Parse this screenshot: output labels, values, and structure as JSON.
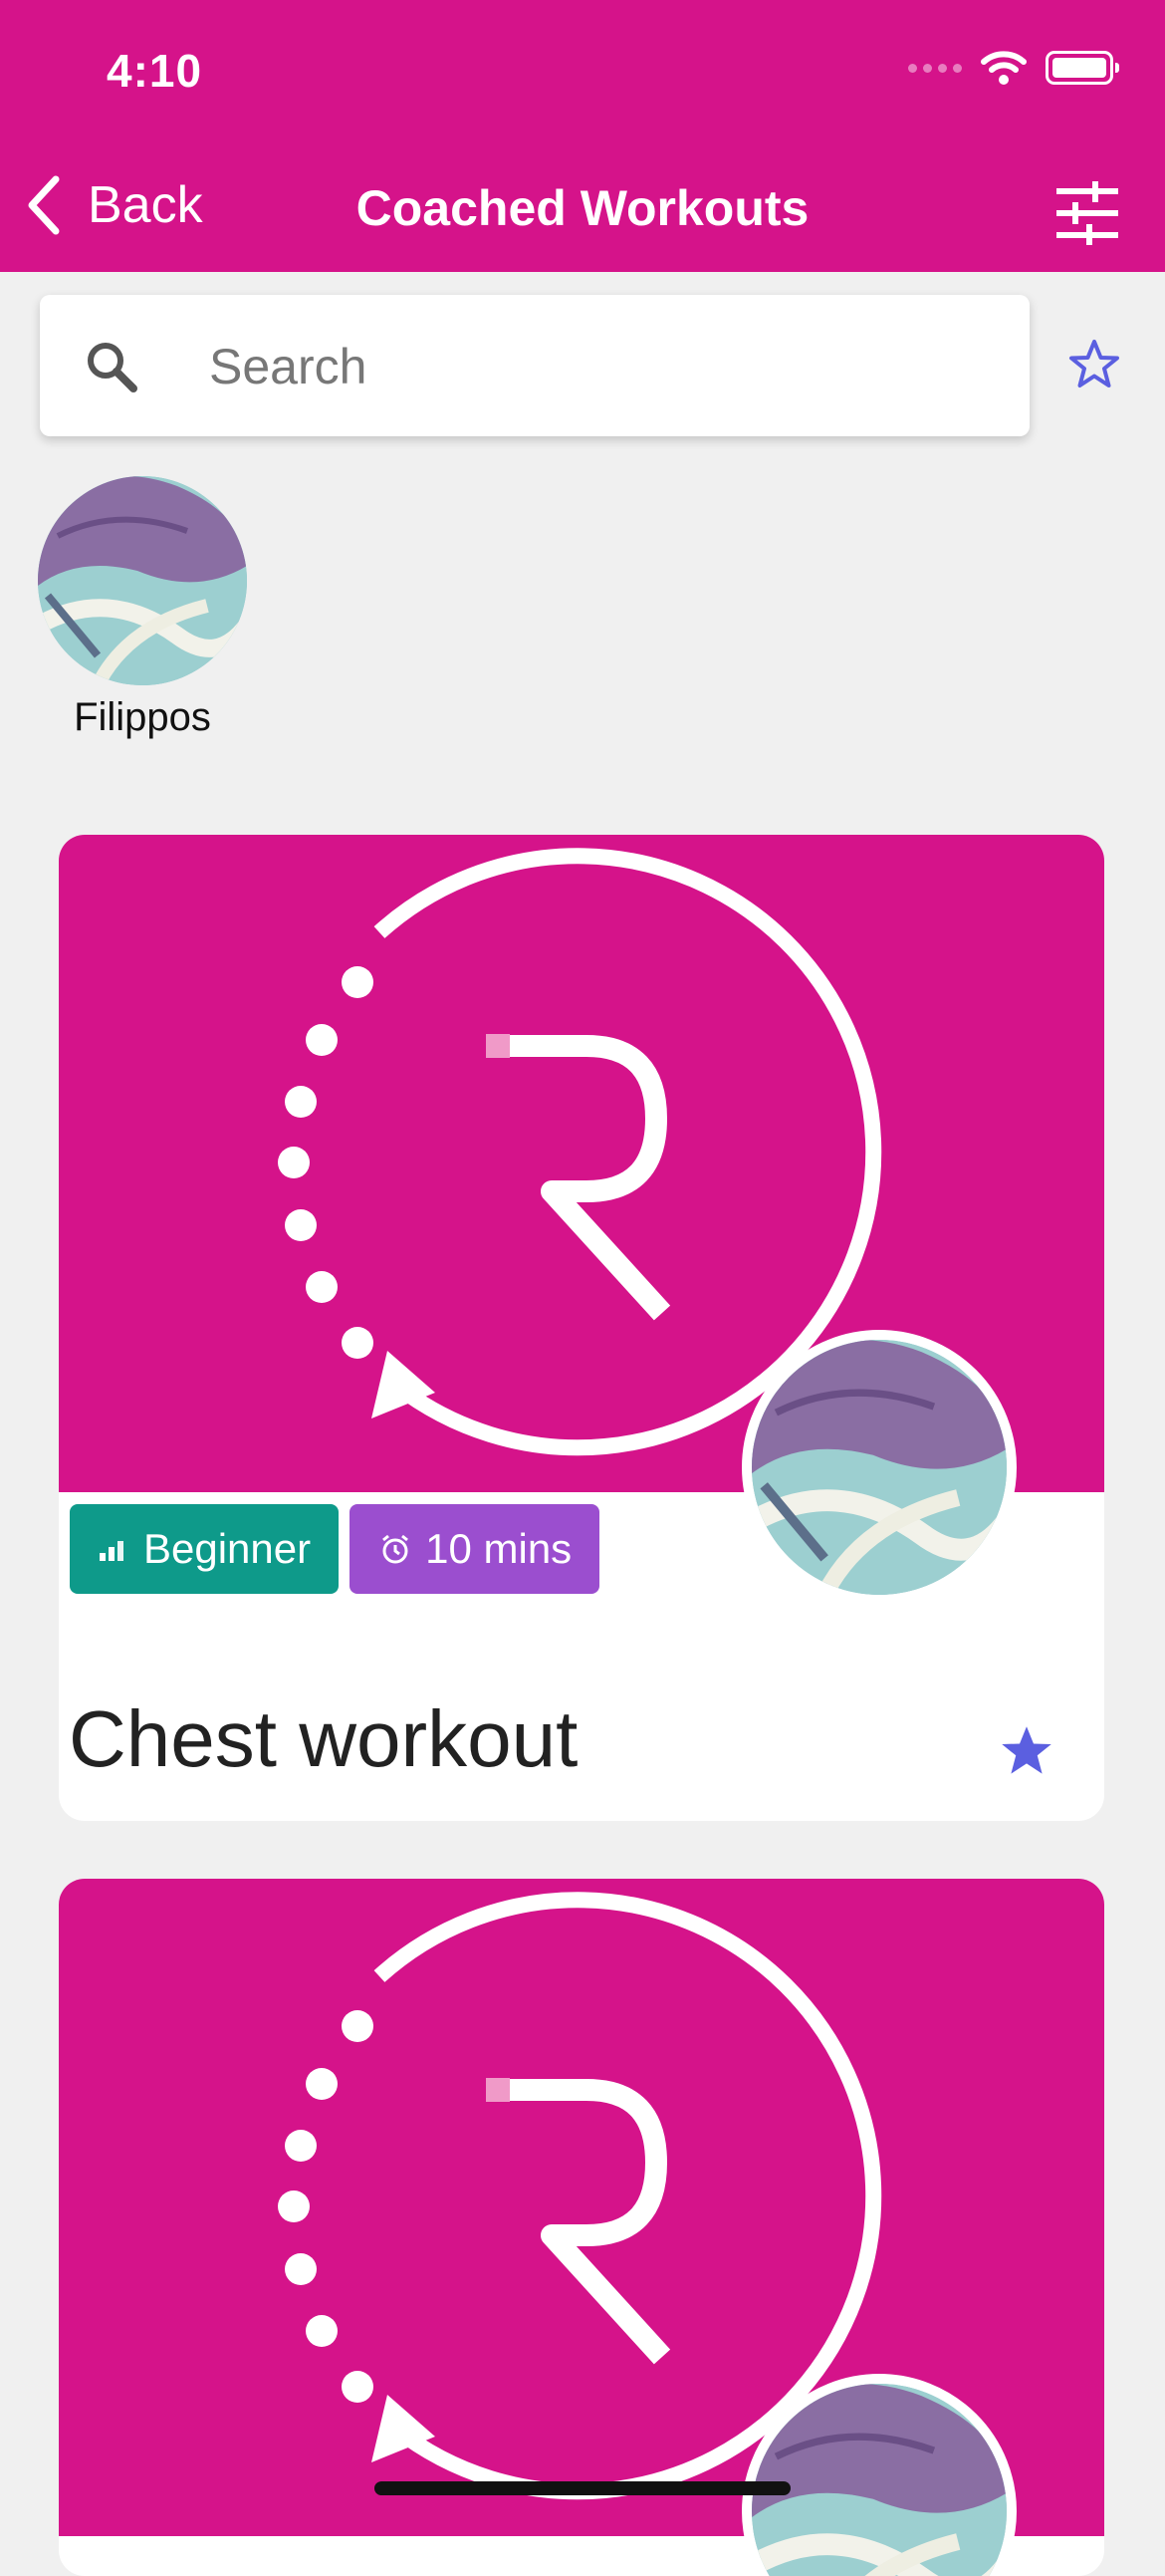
{
  "status_bar": {
    "time": "4:10"
  },
  "nav": {
    "back_label": "Back",
    "title": "Coached Workouts",
    "filter_icon": "sliders-icon"
  },
  "search": {
    "placeholder": "Search",
    "value": ""
  },
  "coaches": [
    {
      "name": "Filippos"
    }
  ],
  "workouts": [
    {
      "level": "Beginner",
      "duration": "10 mins",
      "title": "Chest workout",
      "favorited": true
    },
    {
      "level": "",
      "duration": "",
      "title": "",
      "favorited": false
    }
  ],
  "colors": {
    "brand": "#d5138a",
    "level_tag": "#0e9a8a",
    "duration_tag": "#9b4ecf",
    "star": "#5b5fe0",
    "background": "#f0f0f0"
  }
}
